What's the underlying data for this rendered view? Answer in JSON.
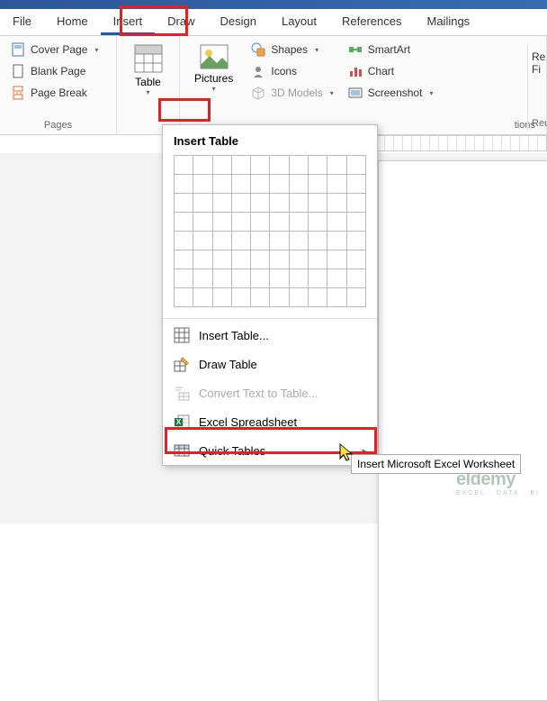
{
  "tabs": [
    "File",
    "Home",
    "Insert",
    "Draw",
    "Design",
    "Layout",
    "References",
    "Mailings"
  ],
  "active_tab_index": 2,
  "ribbon": {
    "pages": {
      "label": "Pages",
      "items": [
        "Cover Page",
        "Blank Page",
        "Page Break"
      ]
    },
    "table": {
      "label": "Table"
    },
    "illustrations": {
      "pictures": "Pictures",
      "shapes": "Shapes",
      "icons": "Icons",
      "models": "3D Models",
      "smartart": "SmartArt",
      "chart": "Chart",
      "screenshot": "Screenshot",
      "label_fragment": "tions"
    },
    "right_fragment": {
      "r": "Re",
      "f": "Fi",
      "label": "Reus"
    }
  },
  "dropdown": {
    "title": "Insert Table",
    "grid_cols": 10,
    "grid_rows": 8,
    "items": [
      {
        "label": "Insert Table...",
        "icon": "table-grid-icon",
        "enabled": true
      },
      {
        "label": "Draw Table",
        "icon": "pencil-table-icon",
        "enabled": true
      },
      {
        "label": "Convert Text to Table...",
        "icon": "text-to-table-icon",
        "enabled": false
      },
      {
        "label": "Excel Spreadsheet",
        "icon": "excel-icon",
        "enabled": true
      },
      {
        "label": "Quick Tables",
        "icon": "quick-tables-icon",
        "enabled": true,
        "submenu": true
      }
    ]
  },
  "tooltip": "Insert Microsoft Excel Worksheet",
  "watermark": {
    "brand": "eldemy",
    "sub": "EXCEL · DATA · BI"
  }
}
